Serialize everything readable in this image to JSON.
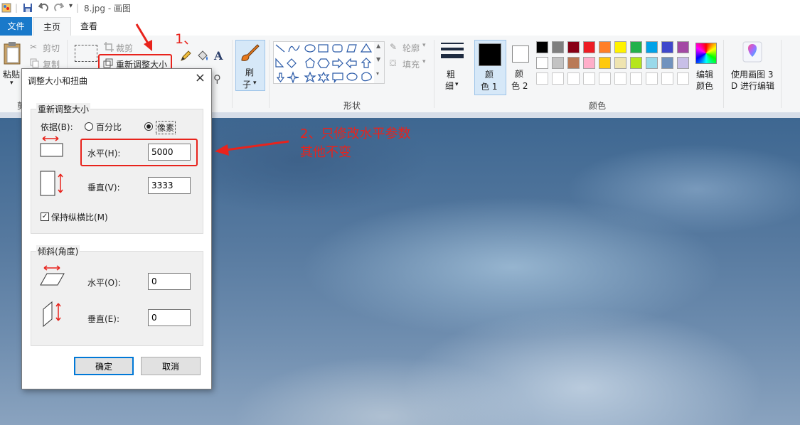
{
  "window": {
    "title": "8.jpg - 画图"
  },
  "tabs": {
    "file": "文件",
    "home": "主页",
    "view": "查看"
  },
  "ribbon": {
    "clipboard": {
      "paste": "粘贴",
      "cut": "剪切",
      "copy": "复制",
      "group_label_fragment": "剪"
    },
    "image": {
      "crop": "裁剪",
      "resize": "重新调整大小"
    },
    "brushes": {
      "label_top": "刷",
      "label_bottom": "子"
    },
    "shapes": {
      "outline": "轮廓",
      "fill": "填充",
      "group_label": "形状"
    },
    "size": {
      "label_top": "粗",
      "label_bottom": "细"
    },
    "color1": {
      "label_top": "颜",
      "label_bottom": "色 1"
    },
    "color2": {
      "label_top": "颜",
      "label_bottom": "色 2"
    },
    "edit_colors": {
      "line1": "编辑",
      "line2": "颜色"
    },
    "paint3d": {
      "line1": "使用画图 3",
      "line2": "D 进行编辑"
    },
    "colors_group_label": "颜色",
    "palette_row1": [
      "#000000",
      "#7f7f7f",
      "#880015",
      "#ed1c24",
      "#ff7f27",
      "#fff200",
      "#22b14c",
      "#00a2e8",
      "#3f48cc",
      "#a349a4"
    ],
    "palette_row2": [
      "#ffffff",
      "#c3c3c3",
      "#b97a57",
      "#ffaec9",
      "#ffc90e",
      "#efe4b0",
      "#b5e61d",
      "#99d9ea",
      "#7092be",
      "#c8bfe7"
    ]
  },
  "dialog": {
    "title": "调整大小和扭曲",
    "close": "×",
    "resize_section": {
      "legend": "重新调整大小",
      "by_label": "依据(B):",
      "percent_label": "百分比",
      "pixels_label": "像素",
      "horizontal_label": "水平(H):",
      "horizontal_value": "5000",
      "vertical_label": "垂直(V):",
      "vertical_value": "3333",
      "keep_aspect_label": "保持纵横比(M)"
    },
    "skew_section": {
      "legend": "倾斜(角度)",
      "horizontal_label": "水平(O):",
      "horizontal_value": "0",
      "vertical_label": "垂直(E):",
      "vertical_value": "0"
    },
    "ok": "确定",
    "cancel": "取消"
  },
  "annotations": {
    "step1": "1、",
    "step2_line1": "2、只修改水平参数",
    "step2_line2": "其他不变",
    "color": "#e8231c"
  }
}
